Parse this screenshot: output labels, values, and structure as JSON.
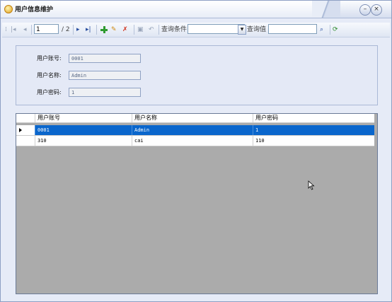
{
  "window": {
    "title": "用户信息维护",
    "minimize_glyph": "–",
    "close_glyph": "×"
  },
  "toolbar": {
    "page_current": "1",
    "page_total": "/ 2",
    "query_condition_label": "查询条件",
    "query_condition_value": "",
    "query_value_label": "查询值",
    "query_value_input": ""
  },
  "form": {
    "account_label": "用户账号:",
    "account_value": "0001",
    "name_label": "用户名称:",
    "name_value": "Admin",
    "password_label": "用户密码:",
    "password_value": "1"
  },
  "grid": {
    "columns": [
      "用户账号",
      "用户名称",
      "用户密码"
    ],
    "rows": [
      [
        "0001",
        "Admin",
        "1"
      ],
      [
        "310",
        "cai",
        "110"
      ]
    ],
    "selected_row": 0
  },
  "colors": {
    "selection": "#0a66cc",
    "grid_empty": "#ababab",
    "panel": "#e4e9f6"
  }
}
